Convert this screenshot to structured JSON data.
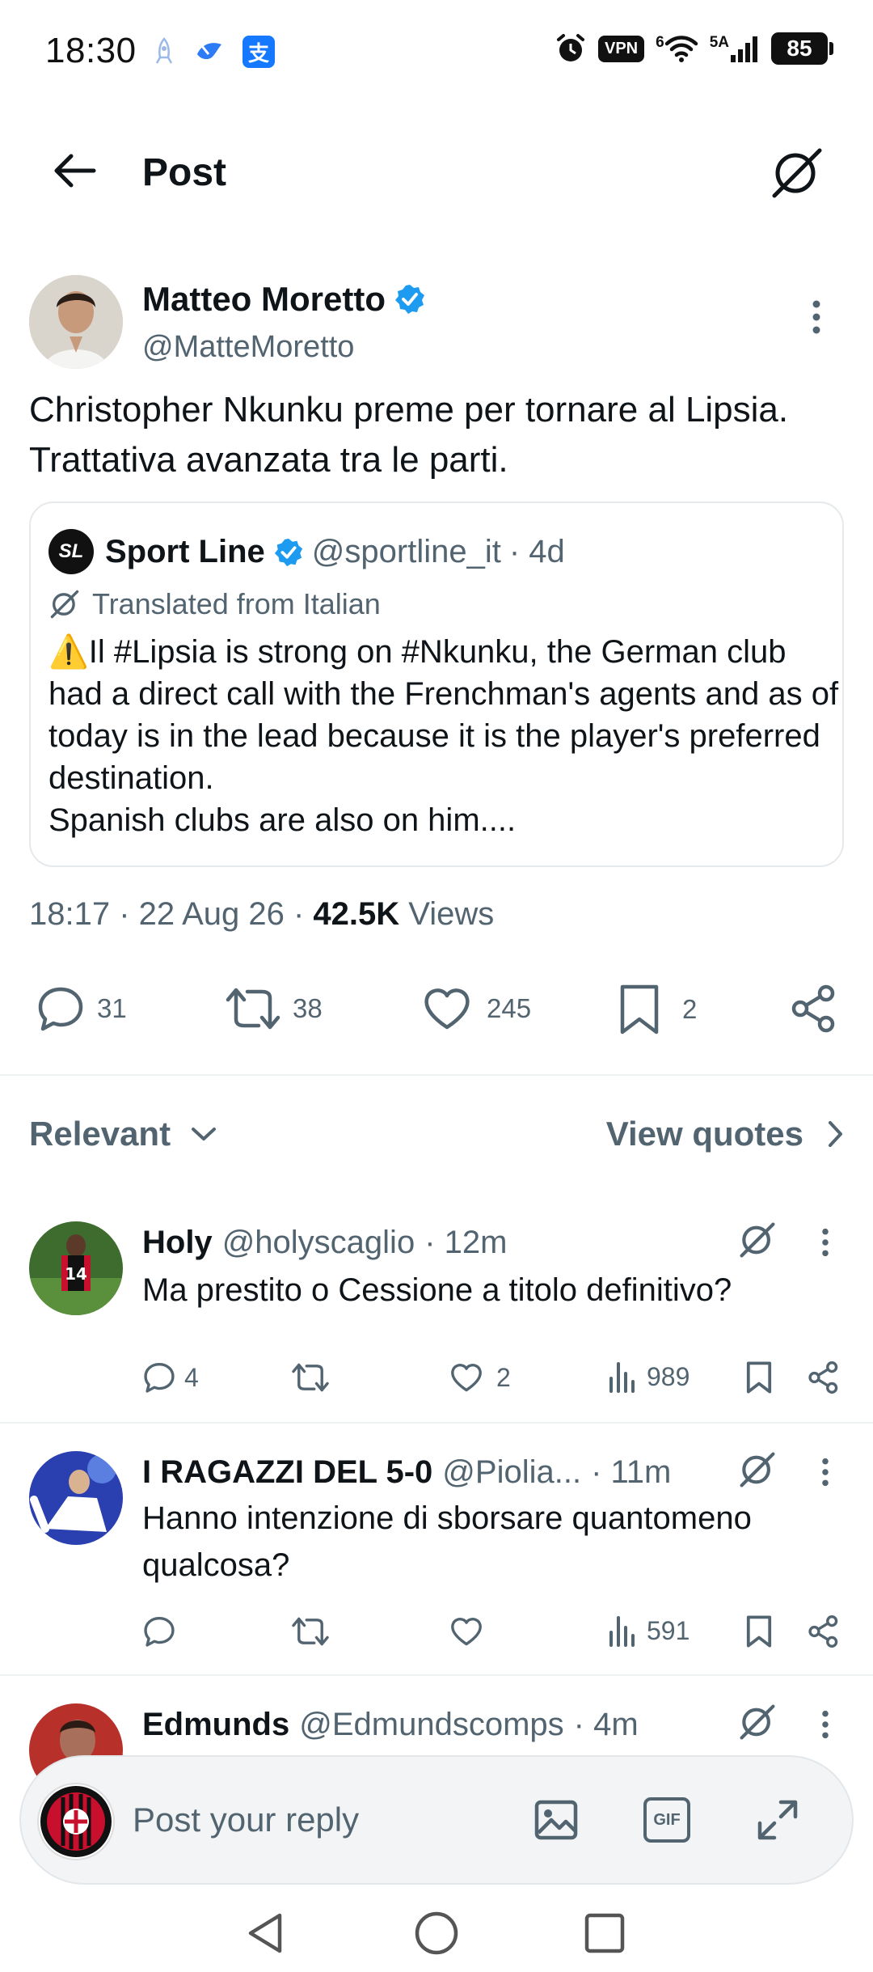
{
  "status_bar": {
    "time": "18:30",
    "vpn": "VPN",
    "wifi_label": "6",
    "signal_label": "5A",
    "battery": "85"
  },
  "header": {
    "title": "Post"
  },
  "post": {
    "author_name": "Matteo Moretto",
    "author_handle": "@MatteMoretto",
    "text": "Christopher Nkunku preme per tornare al Lipsia. Trattativa avanzata tra le parti.",
    "quote": {
      "logo_text": "SL",
      "name": "Sport Line",
      "handle": "@sportline_it",
      "time": "· 4d",
      "translated_label": "Translated from Italian",
      "text": "⚠️Il #Lipsia is strong on #Nkunku, the German club had a direct call with the Frenchman's agents and as of today is in the lead because it is the player's preferred destination.\nSpanish clubs are also on him...."
    },
    "time": "18:17",
    "date": "22 Aug 26",
    "views_count": "42.5K",
    "views_label": "Views",
    "replies": "31",
    "reposts": "38",
    "likes": "245",
    "bookmarks": "2"
  },
  "sort": {
    "label": "Relevant",
    "view_quotes": "View quotes"
  },
  "replies": [
    {
      "name": "Holy",
      "handle": "@holyscaglio",
      "time": "· 12m",
      "text": "Ma prestito o Cessione a titolo definitivo?",
      "reply_count": "4",
      "repost_count": "",
      "like_count": "2",
      "views": "989"
    },
    {
      "name": "I RAGAZZI DEL 5-0",
      "handle": "@Piolia...",
      "time": "· 11m",
      "text": "Hanno intenzione di sborsare quantomeno qualcosa?",
      "reply_count": "",
      "repost_count": "",
      "like_count": "",
      "views": "591"
    },
    {
      "name": "Edmunds",
      "handle": "@Edmundscomps",
      "time": "· 4m"
    }
  ],
  "composer": {
    "placeholder": "Post your reply",
    "gif_label": "GIF"
  },
  "colors": {
    "accent": "#1d9bf0",
    "muted": "#536471",
    "text": "#0f1419"
  }
}
